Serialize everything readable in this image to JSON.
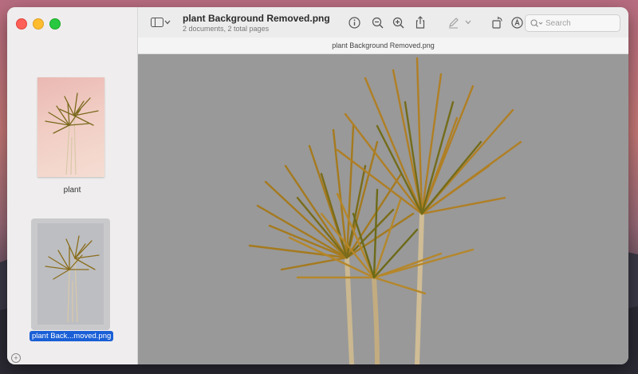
{
  "window": {
    "title": "plant Background Removed.png",
    "subtitle": "2 documents, 2 total pages",
    "file_bar_title": "plant Background Removed.png"
  },
  "sidebar": {
    "items": [
      {
        "label": "plant",
        "selected": false
      },
      {
        "label": "plant Back...moved.png",
        "selected": true
      }
    ]
  },
  "toolbar": {
    "icons": [
      "sidebar-toggle-icon",
      "chevron-down-icon",
      "info-icon",
      "zoom-out-icon",
      "zoom-in-icon",
      "share-icon",
      "markup-pen-icon",
      "chevron-down-icon",
      "rotate-icon",
      "annotate-icon",
      "search-icon"
    ]
  },
  "search": {
    "placeholder": "Search",
    "value": ""
  },
  "colors": {
    "canvas_background": "#999999",
    "selection": "#1a5fd6",
    "close": "#fe5f57",
    "minimize": "#febc2e",
    "maximize": "#28c840"
  }
}
